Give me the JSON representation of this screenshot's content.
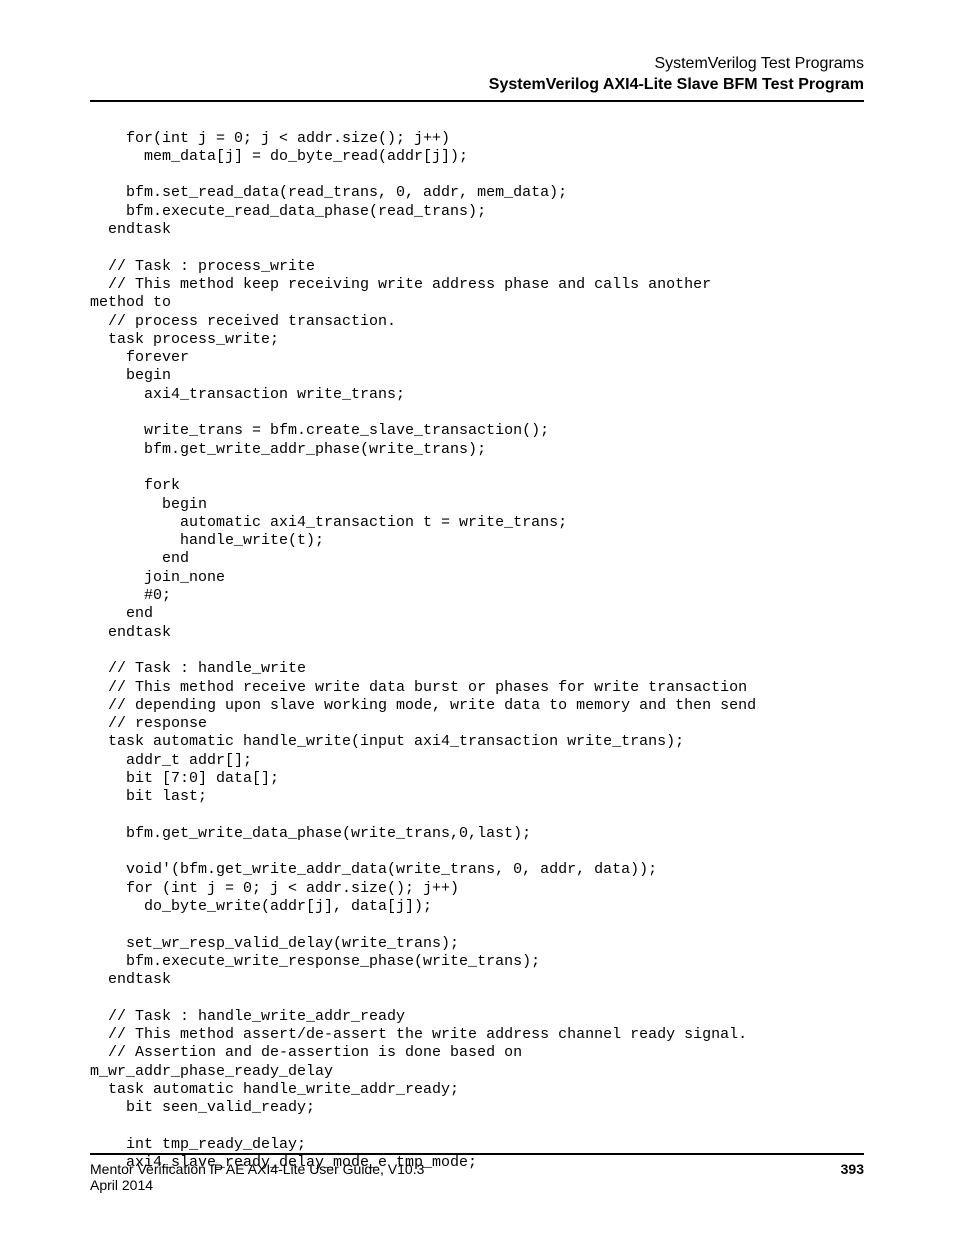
{
  "header": {
    "line1": "SystemVerilog Test Programs",
    "line2": "SystemVerilog AXI4-Lite Slave BFM Test Program"
  },
  "code": {
    "text": "    for(int j = 0; j < addr.size(); j++)\n      mem_data[j] = do_byte_read(addr[j]);\n\n    bfm.set_read_data(read_trans, 0, addr, mem_data);\n    bfm.execute_read_data_phase(read_trans);\n  endtask\n\n  // Task : process_write\n  // This method keep receiving write address phase and calls another\nmethod to\n  // process received transaction.\n  task process_write;\n    forever\n    begin\n      axi4_transaction write_trans;\n\n      write_trans = bfm.create_slave_transaction();\n      bfm.get_write_addr_phase(write_trans);\n\n      fork\n        begin\n          automatic axi4_transaction t = write_trans;\n          handle_write(t);\n        end\n      join_none\n      #0;\n    end\n  endtask\n\n  // Task : handle_write\n  // This method receive write data burst or phases for write transaction\n  // depending upon slave working mode, write data to memory and then send\n  // response\n  task automatic handle_write(input axi4_transaction write_trans);\n    addr_t addr[];\n    bit [7:0] data[];\n    bit last;\n\n    bfm.get_write_data_phase(write_trans,0,last);\n\n    void'(bfm.get_write_addr_data(write_trans, 0, addr, data));\n    for (int j = 0; j < addr.size(); j++)\n      do_byte_write(addr[j], data[j]);\n\n    set_wr_resp_valid_delay(write_trans);\n    bfm.execute_write_response_phase(write_trans);\n  endtask\n\n  // Task : handle_write_addr_ready\n  // This method assert/de-assert the write address channel ready signal.\n  // Assertion and de-assertion is done based on\nm_wr_addr_phase_ready_delay\n  task automatic handle_write_addr_ready;\n    bit seen_valid_ready;\n\n    int tmp_ready_delay;\n    axi4_slave_ready_delay_mode_e tmp_mode;"
  },
  "footer": {
    "title": "Mentor Verification IP AE AXI4-Lite User Guide, V10.3",
    "date": "April 2014",
    "page": "393"
  }
}
